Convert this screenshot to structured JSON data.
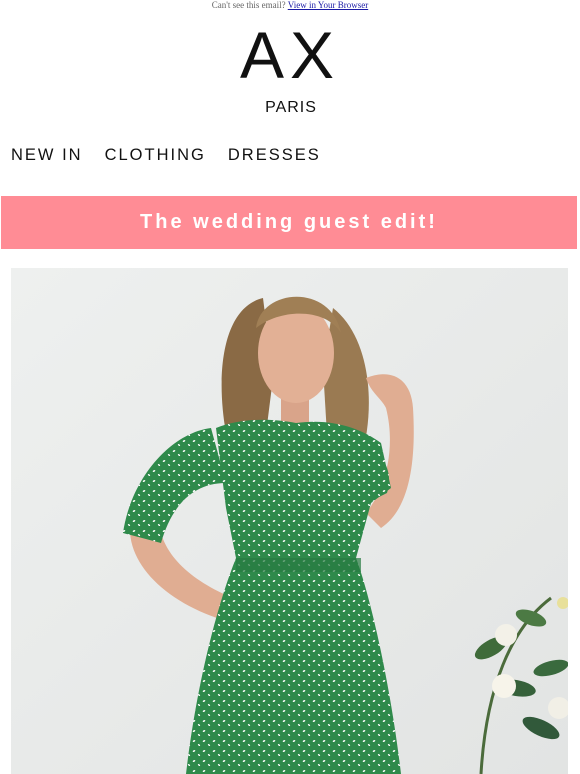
{
  "preheader": {
    "text": "Can't see this email?",
    "link": "View in Your Browser"
  },
  "brand": {
    "logo_mark": "AX",
    "logo_sub": "PARIS"
  },
  "nav": {
    "items": [
      "NEW IN",
      "CLOTHING",
      "DRESSES"
    ]
  },
  "banner": {
    "text": "The wedding guest edit!",
    "color": "#ff8c95"
  },
  "hero": {
    "dress_color": "#2f8a4b",
    "background_color": "#e9eaea"
  }
}
